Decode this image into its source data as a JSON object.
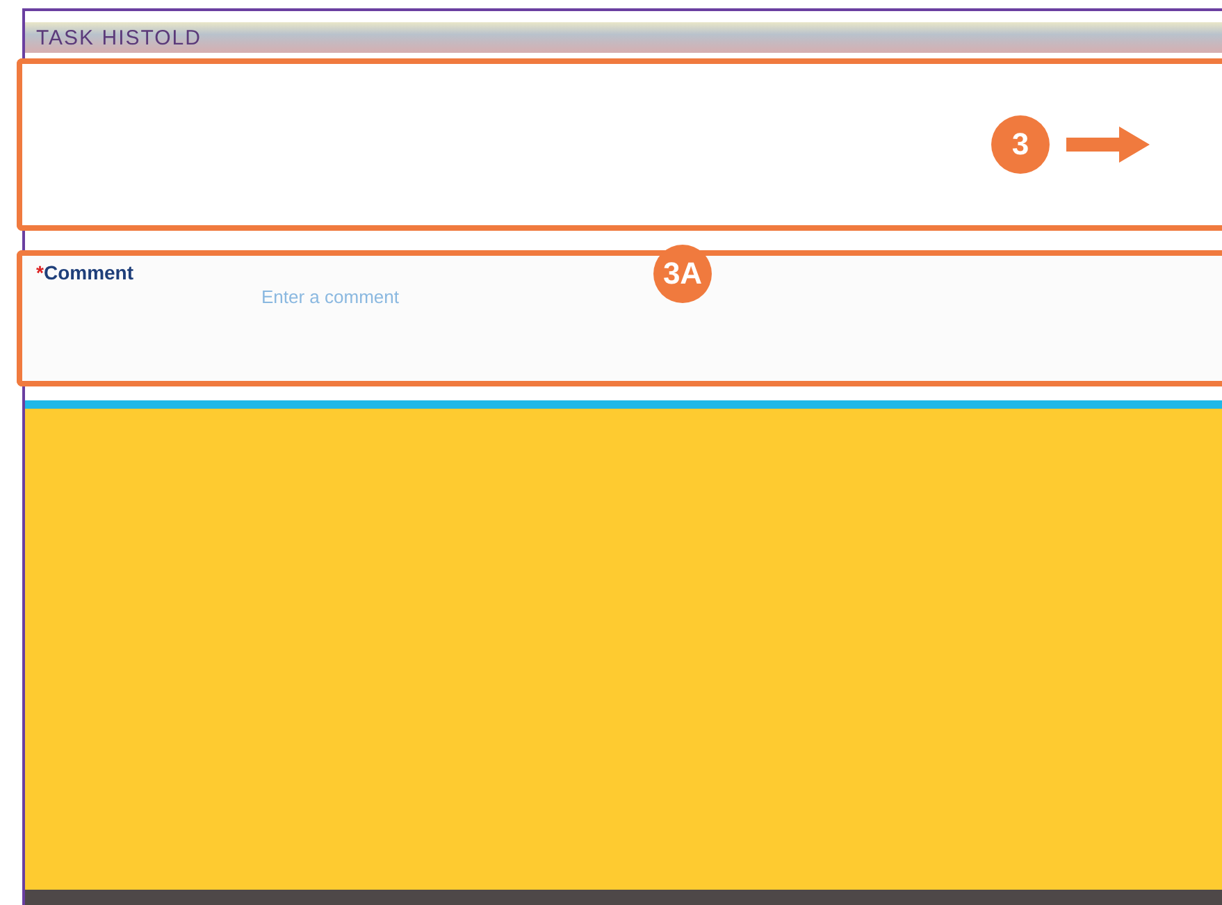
{
  "window": {
    "title": "TASK HISTOLD"
  },
  "callouts": [
    {
      "label": "3"
    },
    {
      "label": "3A"
    }
  ],
  "comment": {
    "label": "Comment",
    "required_mark": "*",
    "placeholder": "Enter a comment"
  }
}
